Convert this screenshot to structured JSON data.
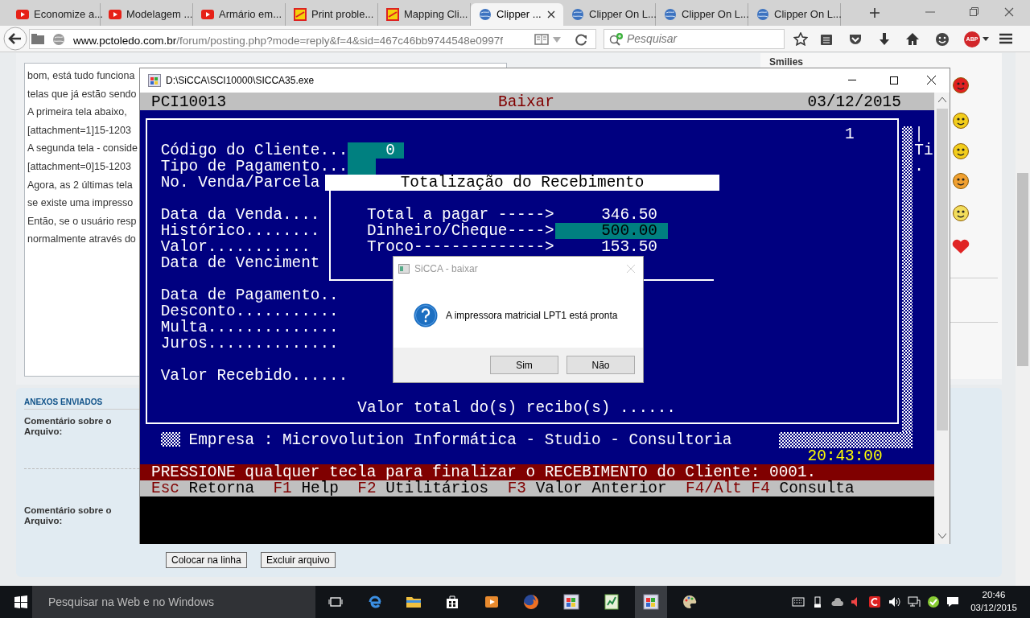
{
  "browser": {
    "tabs": [
      {
        "title": "Economize a...",
        "kind": "video",
        "selected": false
      },
      {
        "title": "Modelagem ...",
        "kind": "video",
        "selected": false
      },
      {
        "title": "Armário em...",
        "kind": "video",
        "selected": false
      },
      {
        "title": "Print proble...",
        "kind": "forum",
        "selected": false
      },
      {
        "title": "Mapping Cli...",
        "kind": "forum",
        "selected": false
      },
      {
        "title": "Clipper ...",
        "kind": "web",
        "selected": true
      },
      {
        "title": "Clipper On L...",
        "kind": "web",
        "selected": false
      },
      {
        "title": "Clipper On L...",
        "kind": "web",
        "selected": false
      },
      {
        "title": "Clipper On L...",
        "kind": "web",
        "selected": false
      }
    ],
    "url_host": "www.pctoledo.com.br",
    "url_path": "/forum/posting.php?mode=reply&f=4&sid=467c46bb9744548e0997f",
    "search_placeholder": "Pesquisar",
    "adblock_label": "ABP"
  },
  "forum": {
    "post_lines": [
      "bom, está tudo funciona",
      "telas que já estão sendo",
      "A primeira tela abaixo,",
      "[attachment=1]15-1203",
      "A segunda tela - conside",
      "[attachment=0]15-1203",
      "Agora, as 2 últimas tela",
      "se existe uma impresso",
      "Então, se o usuário resp",
      "normalmente através do"
    ],
    "smilies_heading": "Smilies",
    "attachments_heading": "ANEXOS ENVIADOS",
    "attachments": [
      {
        "comment_label": "Comentário sobre o Arquivo:"
      },
      {
        "comment_label": "Comentário sobre o Arquivo:"
      }
    ],
    "buttons": [
      "Colocar na linha",
      "Excluir arquivo"
    ]
  },
  "console_window": {
    "title": "D:\\SiCCA\\SCI10000\\SICCA35.exe",
    "program": "PCI10013",
    "screen": "Baixar",
    "date": "03/12/2015",
    "page_number": "1",
    "fields": [
      {
        "label": "Código do Cliente...",
        "input": true,
        "value": "0"
      },
      {
        "label": "Tipo de Pagamento...",
        "input": true
      },
      {
        "label": "No. Venda/Parcela",
        "input": false
      },
      {
        "label": "Data da Venda....",
        "input": false
      },
      {
        "label": "Histórico........",
        "input": false
      },
      {
        "label": "Valor...........",
        "input": false
      },
      {
        "label": "Data de Venciment",
        "input": false
      },
      {
        "label": "Data de Pagamento..",
        "input": false
      },
      {
        "label": "Desconto...........",
        "input": false
      },
      {
        "label": "Multa..............",
        "input": false
      },
      {
        "label": "Juros..............",
        "input": false
      },
      {
        "label": "Valor Recebido......",
        "input": false
      }
    ],
    "totals": {
      "title": "Totalização do Recebimento",
      "rows": [
        {
          "label": "Total a pagar ----->",
          "value": "346.50",
          "highlighted": false
        },
        {
          "label": "Dinheiro/Cheque---->",
          "value": "500.00",
          "highlighted": true
        },
        {
          "label": "Troco-------------->",
          "value": "153.50",
          "highlighted": false
        }
      ]
    },
    "total_line": "Valor total do(s) recibo(s) ......",
    "side_texts": [
      "|",
      "Ti",
      "."
    ],
    "company": "Empresa : Microvolution Informática - Studio - Consultoria",
    "clock": "20:43:00",
    "message": "PRESSIONE qualquer tecla para finalizar o RECEBIMENTO do Cliente: 0001.",
    "hotkeys": [
      {
        "key": "Esc",
        "action": "Retorna"
      },
      {
        "key": "F1",
        "action": "Help"
      },
      {
        "key": "F2",
        "action": "Utilitários"
      },
      {
        "key": "F3",
        "action": "Valor Anterior"
      },
      {
        "key": "F4/Alt F4",
        "action": "Consulta"
      }
    ]
  },
  "dialog": {
    "title": "SiCCA - baixar",
    "message": "A impressora matricial LPT1 está pronta",
    "buttons": [
      "Sim",
      "Não"
    ]
  },
  "taskbar": {
    "search_placeholder": "Pesquisar na Web e no Windows",
    "time": "20:46",
    "date": "03/12/2015"
  }
}
